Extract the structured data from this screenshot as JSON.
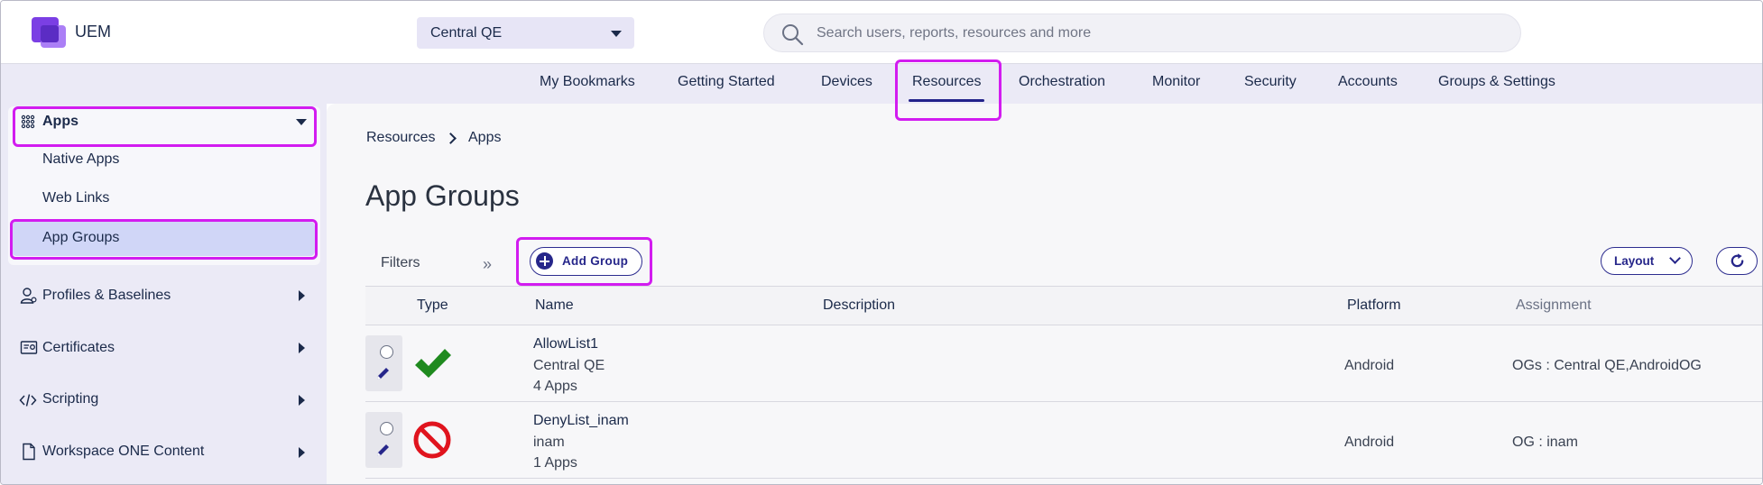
{
  "header": {
    "app_title": "UEM",
    "org_selector": {
      "value": "Central QE"
    },
    "search": {
      "placeholder": "Search users, reports, resources and more"
    }
  },
  "nav": {
    "items": [
      {
        "label": "My Bookmarks"
      },
      {
        "label": "Getting Started"
      },
      {
        "label": "Devices"
      },
      {
        "label": "Resources",
        "active": true
      },
      {
        "label": "Orchestration"
      },
      {
        "label": "Monitor"
      },
      {
        "label": "Security"
      },
      {
        "label": "Accounts"
      },
      {
        "label": "Groups & Settings"
      }
    ]
  },
  "sidebar": {
    "apps": {
      "label": "Apps",
      "icon": "grid-icon",
      "children": [
        {
          "label": "Native Apps"
        },
        {
          "label": "Web Links"
        },
        {
          "label": "App Groups",
          "active": true
        }
      ]
    },
    "sections": [
      {
        "label": "Profiles & Baselines",
        "icon": "profile-icon"
      },
      {
        "label": "Certificates",
        "icon": "certificate-icon"
      },
      {
        "label": "Scripting",
        "icon": "code-icon"
      },
      {
        "label": "Workspace ONE Content",
        "icon": "document-icon"
      }
    ]
  },
  "breadcrumb": {
    "items": [
      "Resources",
      "Apps"
    ]
  },
  "page": {
    "title": "App Groups"
  },
  "toolbar": {
    "filters_label": "Filters",
    "add_group_label": "Add Group",
    "layout_label": "Layout"
  },
  "table": {
    "columns": [
      "Type",
      "Name",
      "Description",
      "Platform",
      "Assignment"
    ],
    "rows": [
      {
        "type": "allow-list",
        "type_icon": "checkmark-icon",
        "name": "AllowList1",
        "org": "Central QE",
        "app_count": "4 Apps",
        "description": "",
        "platform": "Android",
        "assignment": "OGs : Central QE,AndroidOG"
      },
      {
        "type": "deny-list",
        "type_icon": "prohibited-icon",
        "name": "DenyList_inam",
        "org": "inam",
        "app_count": "1 Apps",
        "description": "",
        "platform": "Android",
        "assignment": "OG : inam"
      }
    ]
  },
  "colors": {
    "accent": "#26268a",
    "highlight": "#d21cf0",
    "nav_bg": "#ebeaf6",
    "active_item_bg": "#d0d6f7",
    "allow_green": "#1f8a1f",
    "deny_red": "#e0141e"
  }
}
